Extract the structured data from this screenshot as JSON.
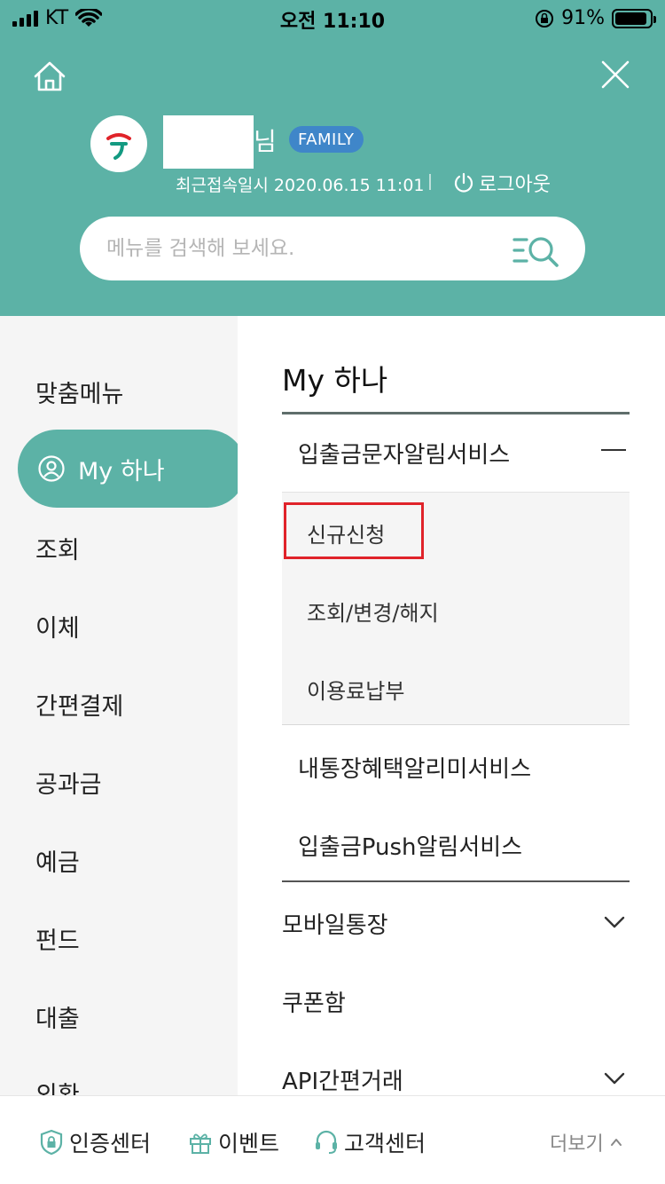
{
  "status_bar": {
    "carrier": "KT",
    "time": "오전 11:10",
    "battery_percent": "91%",
    "battery_level": 0.91
  },
  "header": {
    "name_suffix": "님",
    "badge": "FAMILY",
    "last_login": "최근접속일시 2020.06.15 11:01",
    "logout": "로그아웃",
    "search_placeholder": "메뉴를 검색해 보세요."
  },
  "left_nav": {
    "items": [
      "맞춤메뉴",
      "My 하나",
      "조회",
      "이체",
      "간편결제",
      "공과금",
      "예금",
      "펀드",
      "대출",
      "외환"
    ],
    "active_index": 1
  },
  "content": {
    "title": "My 하나",
    "groups": [
      {
        "label": "입출금문자알림서비스",
        "expanded": true,
        "children": [
          "신규신청",
          "조회/변경/해지",
          "이용료납부"
        ]
      },
      {
        "label": "내통장혜택알리미서비스"
      },
      {
        "label": "입출금Push알림서비스"
      }
    ],
    "menu": [
      {
        "label": "모바일통장",
        "expandable": true
      },
      {
        "label": "쿠폰함",
        "expandable": false
      },
      {
        "label": "API간편거래",
        "expandable": true
      }
    ]
  },
  "bottom_bar": {
    "cert_center": "인증센터",
    "event": "이벤트",
    "customer_center": "고객센터",
    "more": "더보기"
  },
  "colors": {
    "brand": "#5cb2a6",
    "badge": "#3f86c9",
    "highlight": "#e0232a",
    "logo_red": "#e0232a",
    "logo_green": "#139a81"
  }
}
